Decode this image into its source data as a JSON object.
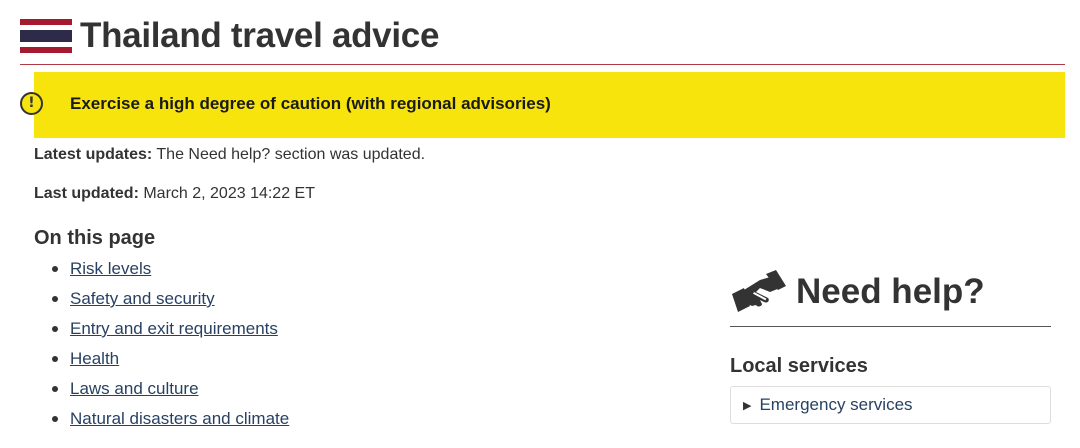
{
  "page": {
    "title": "Thailand travel advice",
    "flag_icon": "thailand-flag-icon"
  },
  "alert": {
    "icon": "exclamation-circle-icon",
    "icon_glyph": "!",
    "text": "Exercise a high degree of caution (with regional advisories)",
    "color": "#f7e40d"
  },
  "updates": {
    "latest_label": "Latest updates:",
    "latest_value": " The Need help? section was updated.",
    "last_label": "Last updated:",
    "last_value": " March 2, 2023 14:22 ET"
  },
  "toc": {
    "heading": "On this page",
    "items": [
      {
        "label": "Risk levels"
      },
      {
        "label": "Safety and security"
      },
      {
        "label": "Entry and exit requirements"
      },
      {
        "label": "Health"
      },
      {
        "label": "Laws and culture"
      },
      {
        "label": "Natural disasters and climate"
      }
    ]
  },
  "help": {
    "icon": "handshake-icon",
    "title": "Need help?",
    "local_services_heading": "Local services",
    "emergency_toggle_glyph": "▶",
    "emergency_label": "Emergency services"
  },
  "colors": {
    "link": "#284162",
    "title_rule": "#af3c43"
  }
}
